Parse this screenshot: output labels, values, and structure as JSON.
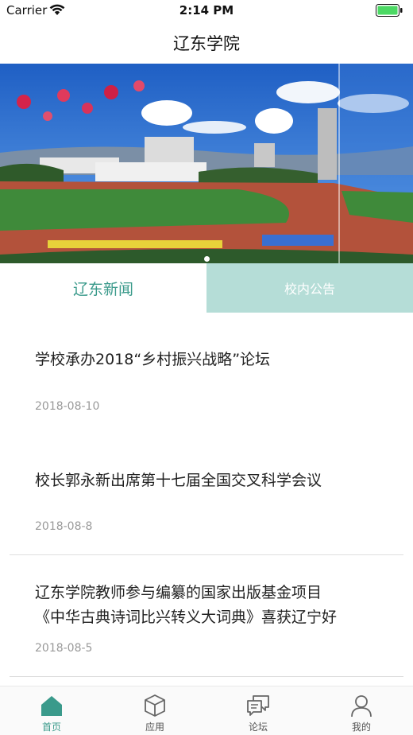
{
  "status_bar": {
    "carrier": "Carrier",
    "time": "2:14 PM"
  },
  "nav": {
    "title": "辽东学院"
  },
  "banner": {
    "current_page": 1,
    "page_count": 1
  },
  "tabs": [
    {
      "label": "辽东新闻",
      "active": true
    },
    {
      "label": "校内公告",
      "active": false
    }
  ],
  "news": [
    {
      "title": "学校承办2018“乡村振兴战略”论坛",
      "date": "2018-08-10"
    },
    {
      "title": "校长郭永新出席第十七届全国交叉科学会议",
      "date": "2018-08-8"
    },
    {
      "title_line1": "辽东学院教师参与编纂的国家出版基金项目",
      "title_line2": "《中华古典诗词比兴转义大词典》喜获辽宁好",
      "date": "2018-08-5"
    }
  ],
  "tab_bar": {
    "items": [
      {
        "label": "首页",
        "icon": "home-icon",
        "active": true
      },
      {
        "label": "应用",
        "icon": "cube-icon",
        "active": false
      },
      {
        "label": "论坛",
        "icon": "chat-icon",
        "active": false
      },
      {
        "label": "我的",
        "icon": "person-icon",
        "active": false
      }
    ]
  },
  "colors": {
    "accent": "#3a9a8b",
    "tab_inactive_bg": "#b5ddd7",
    "battery": "#4cd964"
  }
}
